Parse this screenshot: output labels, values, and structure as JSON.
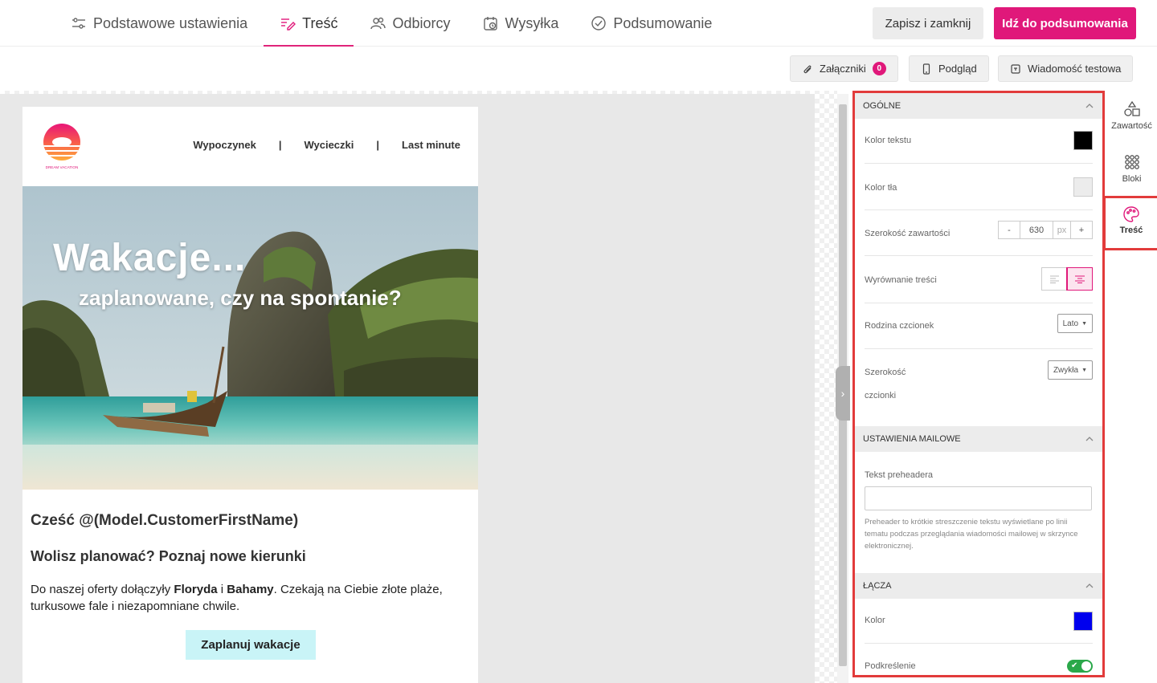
{
  "nav": {
    "tabs": [
      {
        "label": "Podstawowe ustawienia",
        "icon": "sliders-icon"
      },
      {
        "label": "Treść",
        "icon": "content-edit-icon",
        "active": true
      },
      {
        "label": "Odbiorcy",
        "icon": "users-icon"
      },
      {
        "label": "Wysyłka",
        "icon": "calendar-clock-icon"
      },
      {
        "label": "Podsumowanie",
        "icon": "check-circle-icon"
      }
    ],
    "save_label": "Zapisz i zamknij",
    "primary_label": "Idź do podsumowania"
  },
  "toolbar": {
    "attachments_label": "Załączniki",
    "attachments_count": "0",
    "preview_label": "Podgląd",
    "test_label": "Wiadomość testowa"
  },
  "email": {
    "logo_text": "DREAM VACATION",
    "menu": [
      "Wypoczynek",
      "|",
      "Wycieczki",
      "|",
      "Last minute"
    ],
    "hero_title": "Wakacje...",
    "hero_sub": "zaplanowane, czy na spontanie?",
    "greeting": "Cześć @(Model.CustomerFirstName)",
    "heading": "Wolisz planować? Poznaj nowe kierunki",
    "para_1": "Do naszej oferty dołączyły ",
    "para_b1": "Floryda",
    "para_2": " i ",
    "para_b2": "Bahamy",
    "para_3": ". Czekają na Ciebie złote plaże, turkusowe fale i niezapomniane chwile.",
    "cta": "Zaplanuj wakacje"
  },
  "panel": {
    "general": {
      "title": "OGÓLNE",
      "text_color_label": "Kolor tekstu",
      "text_color": "#000000",
      "bg_color_label": "Kolor tła",
      "bg_color": "#ececec",
      "width_label": "Szerokość zawartości",
      "width_minus": "-",
      "width_value": "630",
      "width_unit": "px",
      "width_plus": "+",
      "align_label": "Wyrównanie treści",
      "font_family_label": "Rodzina czcionek",
      "font_family_value": "Lato",
      "font_weight_label_1": "Szerokość",
      "font_weight_label_2": "czcionki",
      "font_weight_value": "Zwykła"
    },
    "mail": {
      "title": "USTAWIENIA MAILOWE",
      "preheader_label": "Tekst preheadera",
      "preheader_value": "",
      "preheader_hint": "Preheader to krótkie streszczenie tekstu wyświetlane po linii tematu podczas przeglądania wiadomości mailowej w skrzynce elektronicznej."
    },
    "links": {
      "title": "ŁĄCZA",
      "color_label": "Kolor",
      "color": "#0000ee",
      "underline_label": "Podkreślenie",
      "underline_on": true
    }
  },
  "rail": {
    "items": [
      {
        "label": "Zawartość",
        "icon": "shapes-icon"
      },
      {
        "label": "Bloki",
        "icon": "grid-icon"
      },
      {
        "label": "Treść",
        "icon": "palette-icon",
        "active": true
      }
    ]
  },
  "colors": {
    "accent": "#e0187a",
    "highlight": "#e23b3b",
    "cta_bg": "#c9f4f7"
  }
}
